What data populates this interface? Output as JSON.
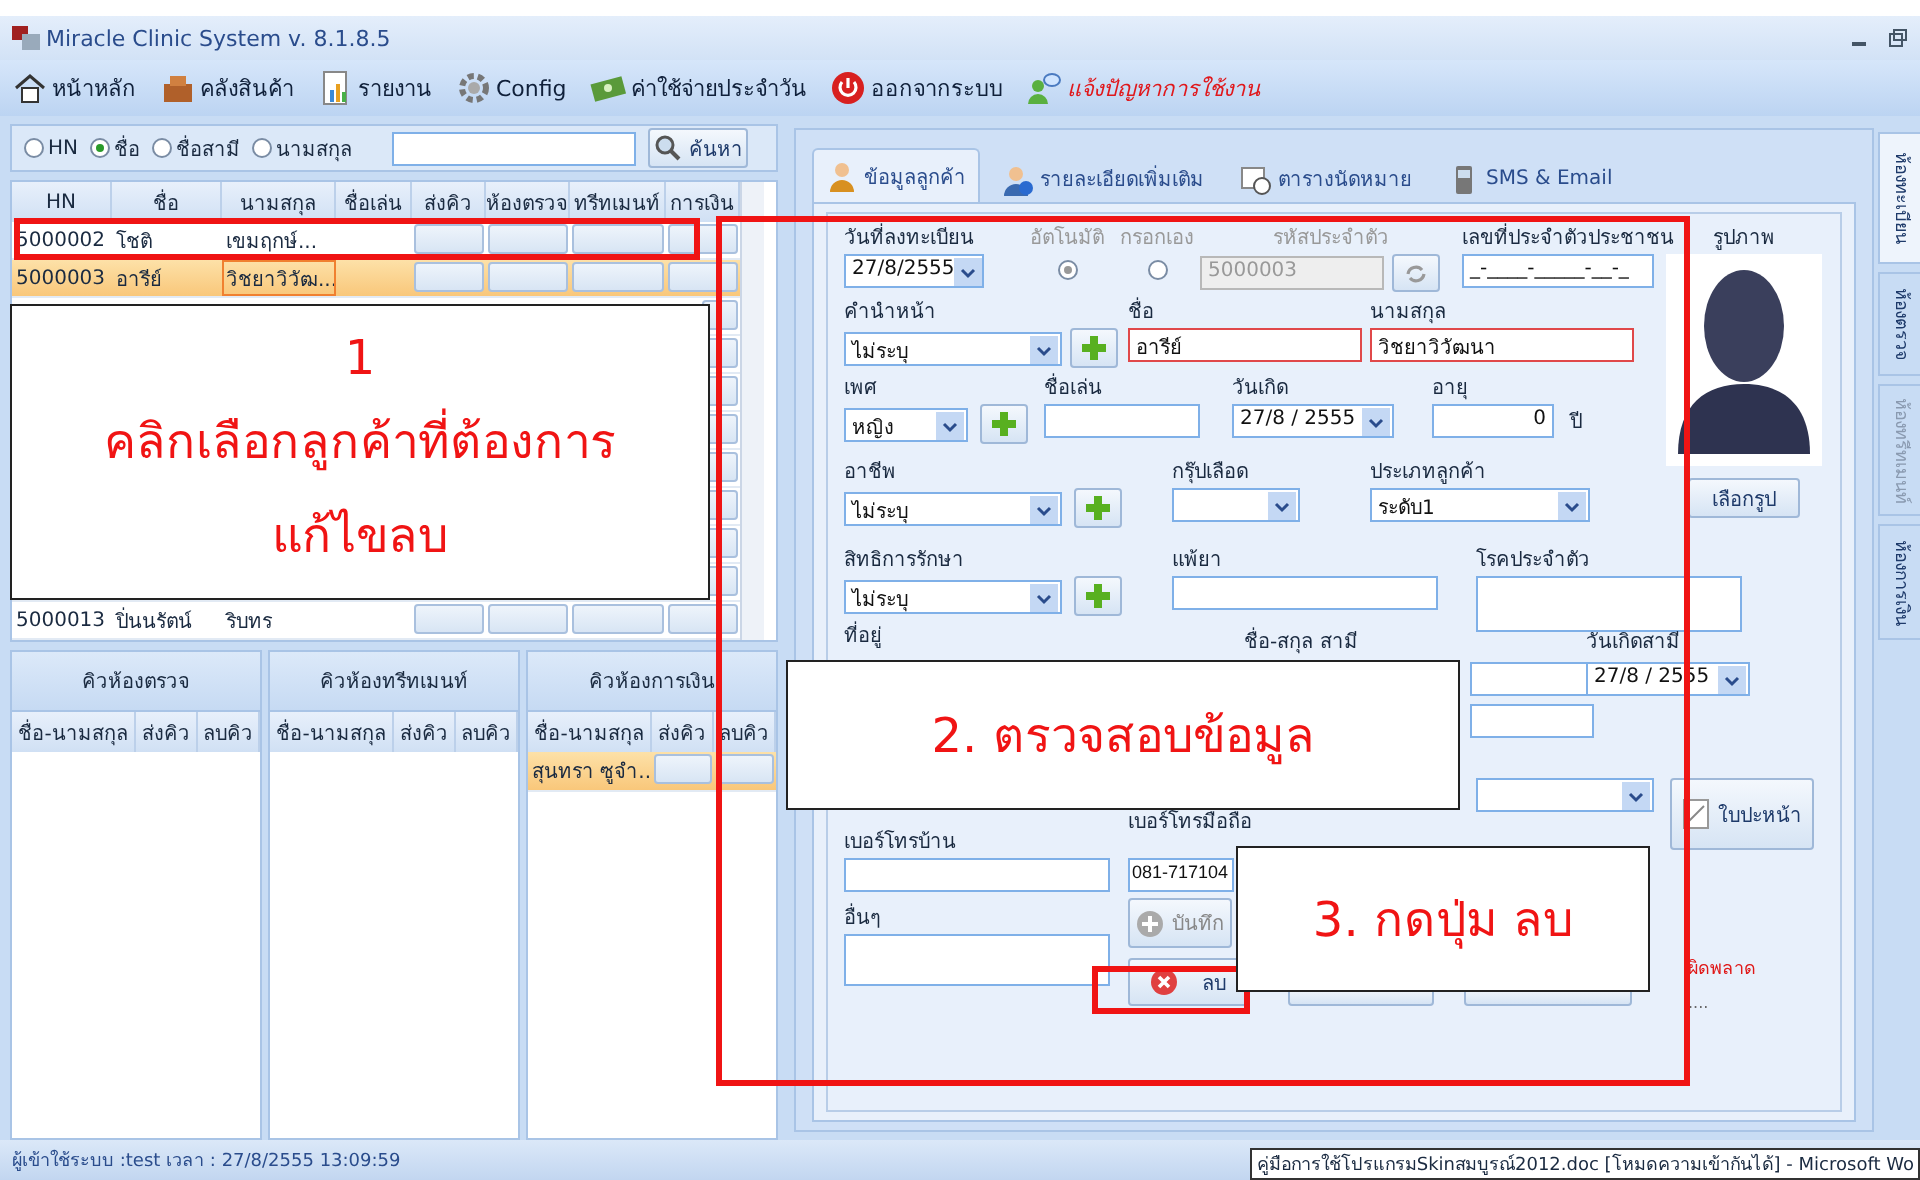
{
  "window": {
    "title": "Miracle Clinic System v. 8.1.8.5"
  },
  "toolbar": [
    {
      "kind": "home",
      "label": "หน้าหลัก"
    },
    {
      "kind": "stock",
      "label": "คลังสินค้า"
    },
    {
      "kind": "report",
      "label": "รายงาน"
    },
    {
      "kind": "config",
      "label": "Config"
    },
    {
      "kind": "expense",
      "label": "ค่าใช้จ่ายประจำวัน"
    },
    {
      "kind": "logout",
      "label": "ออกจากระบบ"
    },
    {
      "kind": "help",
      "label": "แจ้งปัญหาการใช้งาน"
    }
  ],
  "customers": {
    "search_options": [
      {
        "label": "HN",
        "selected": false
      },
      {
        "label": "ชื่อ",
        "selected": true
      },
      {
        "label": "ชื่อสามี",
        "selected": false
      },
      {
        "label": "นามสกุล",
        "selected": false
      }
    ],
    "search_button": "ค้นหา",
    "columns": [
      "HN",
      "ชื่อ",
      "นามสกุล",
      "ชื่อเล่น",
      "ส่งคิว",
      "ห้องตรวจ",
      "ทรีทเมนท์",
      "การเงิน"
    ],
    "rows": [
      {
        "hn": "5000002",
        "name": "โชติ",
        "surname": "เขมฤกษ์...",
        "selected": false
      },
      {
        "hn": "5000003",
        "name": "อารีย์",
        "surname": "วิชยาวิวัฒ...",
        "selected": true
      }
    ],
    "bottom_row": {
      "hn": "5000013",
      "name": "ปิ่นนรัตน์",
      "surname": "ริบทร",
      "selected": false
    }
  },
  "queues": [
    {
      "title": "คิวห้องตรวจ",
      "columns": [
        "ชื่อ-นามสกุล",
        "ส่งคิว",
        "ลบคิว"
      ]
    },
    {
      "title": "คิวห้องทรีทเมนท์",
      "columns": [
        "ชื่อ-นามสกุล",
        "ส่งคิว",
        "ลบคิว"
      ]
    },
    {
      "title": "คิวห้องการเงิน",
      "columns": [
        "ชื่อ-นามสกุล",
        "ส่งคิว",
        "ลบคิว"
      ],
      "entries": [
        {
          "name": "สุนทรา ซูจำ...",
          "selected": true
        }
      ]
    }
  ],
  "tabs": [
    {
      "kind": "person",
      "label": "ข้อมูลลูกค้า",
      "selected": true
    },
    {
      "kind": "info",
      "label": "รายละเอียดเพิ่มเติม",
      "selected": false
    },
    {
      "kind": "clock",
      "label": "ตารางนัดหมาย",
      "selected": false
    },
    {
      "kind": "phone",
      "label": "SMS & Email",
      "selected": false
    }
  ],
  "side_tabs": [
    {
      "label": "ห้องทะเบียน",
      "selected": true,
      "disabled": false
    },
    {
      "label": "ห้องตรวจ",
      "selected": false,
      "disabled": false
    },
    {
      "label": "ห้องทรีทเมนท์",
      "selected": false,
      "disabled": true
    },
    {
      "label": "ห้องการเงิน",
      "selected": false,
      "disabled": false
    }
  ],
  "form": {
    "registered": {
      "label": "วันที่ลงทะเบียน",
      "value": "27/8/2555"
    },
    "id_mode": [
      {
        "label": "อัตโนมัติ",
        "selected": true
      },
      {
        "label": "กรอกเอง",
        "selected": false
      }
    ],
    "customer_code": {
      "label": "รหัสประจำตัว",
      "value": "5000003",
      "disabled": true
    },
    "national_id": {
      "label": "เลขที่ประจำตัวประชาชน",
      "value": "_-____-_____-__-_"
    },
    "title": {
      "label": "คำนำหน้า",
      "value": "ไม่ระบุ"
    },
    "first_name": {
      "label": "ชื่อ",
      "value": "อารีย์",
      "required": true
    },
    "last_name": {
      "label": "นามสกุล",
      "value": "วิชยาวิวัฒนา",
      "required": true
    },
    "sex": {
      "label": "เพศ",
      "value": "หญิง"
    },
    "nickname": {
      "label": "ชื่อเล่น"
    },
    "birthday": {
      "label": "วันเกิด",
      "value": "27/8 / 2555"
    },
    "age": {
      "label": "อายุ",
      "value": "0",
      "unit": "ปี"
    },
    "occupation": {
      "label": "อาชีพ",
      "value": "ไม่ระบุ"
    },
    "blood_group": {
      "label": "กรุ๊ปเลือด"
    },
    "customer_type": {
      "label": "ประเภทลูกค้า",
      "value": "ระดับ1"
    },
    "coverage": {
      "label": "สิทธิการรักษา",
      "value": "ไม่ระบุ"
    },
    "allergy": {
      "label": "แพ้ยา"
    },
    "chronic": {
      "label": "โรคประจำตัว"
    },
    "address": {
      "label": "ที่อยู่"
    },
    "husband_name": {
      "label": "ชื่อ-สกุล สามี"
    },
    "husband_birthday": {
      "label": "วันเกิดสามี",
      "value": "27/8 / 2555"
    },
    "home_phone": {
      "label": "เบอร์โทรบ้าน"
    },
    "mobile": {
      "label": "เบอร์โทรมือถือ",
      "value": "081-717104"
    },
    "other": {
      "label": "อื่นๆ"
    },
    "photo": {
      "label": "รูปภาพ",
      "button": "เลือกรูป"
    },
    "cover_button": "ใบปะหน้า",
    "save_button": {
      "label": "บันทึก",
      "disabled": true
    },
    "delete_button": {
      "label": "ลบ"
    },
    "status": {
      "message": "ผิดพลาด",
      "detail": "...."
    }
  },
  "callouts": [
    {
      "lines": [
        "1",
        "คลิกเลือกลูกค้าที่ต้องการ",
        "แก้ไขลบ"
      ]
    },
    {
      "lines": [
        "2. ตรวจสอบข้อมูล"
      ]
    },
    {
      "lines": [
        "3. กดปุ่ม ลบ"
      ]
    }
  ],
  "status_bar": {
    "user": "ผู้เข้าใช้ระบบ :test",
    "time": "เวลา : 27/8/2555 13:09:59",
    "task": "คู่มือการใช้โปรแกรมSkinสมบูรณ์2012.doc [โหมดความเข้ากันได้] - Microsoft Wo"
  }
}
